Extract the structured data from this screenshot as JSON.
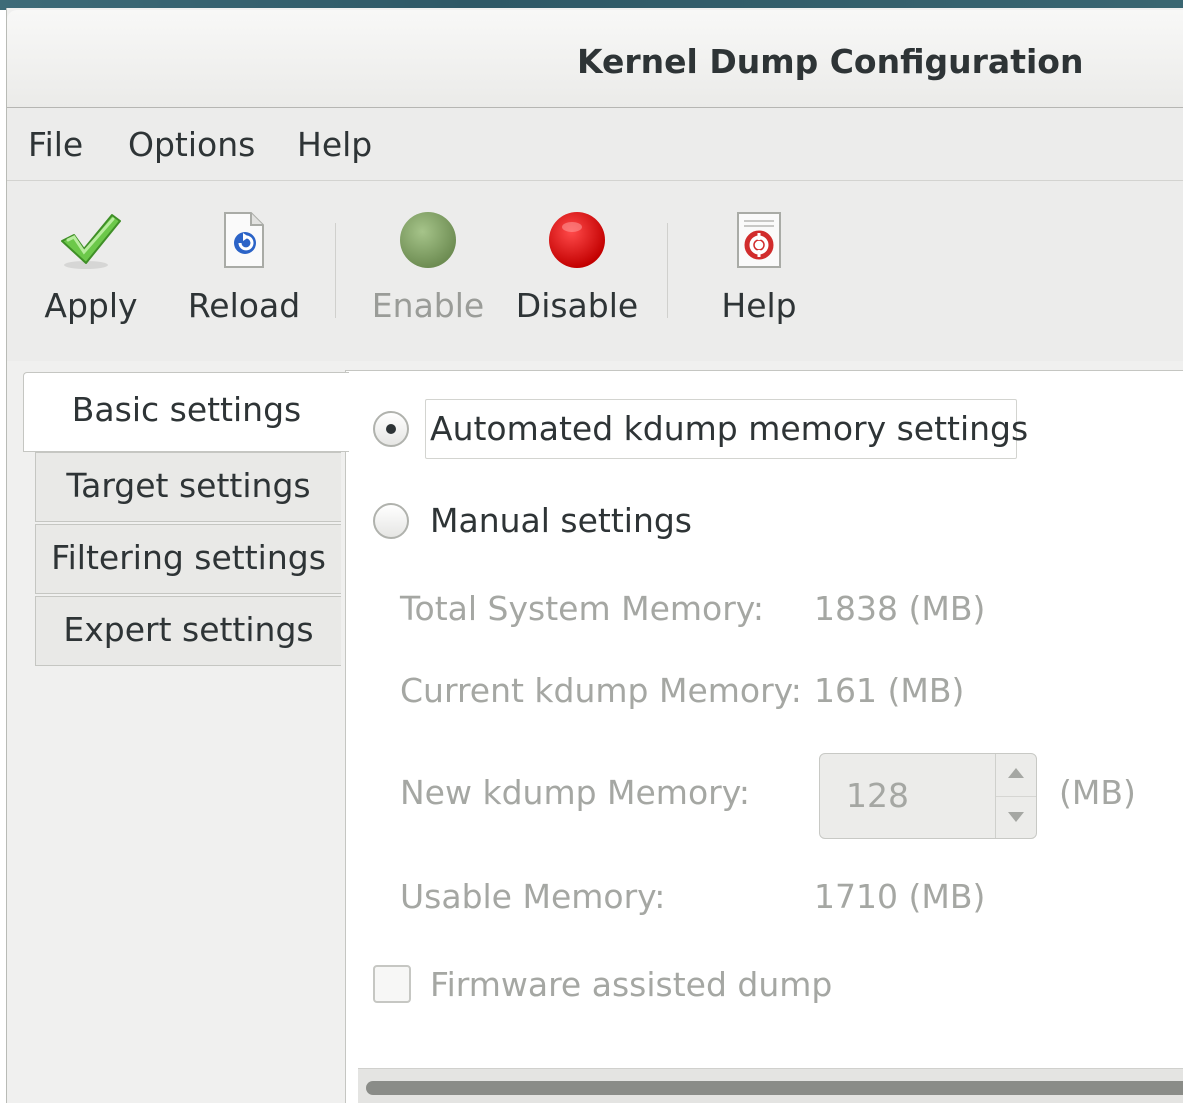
{
  "window": {
    "title": "Kernel Dump Configuration"
  },
  "menu": {
    "items": [
      {
        "label": "File"
      },
      {
        "label": "Options"
      },
      {
        "label": "Help"
      }
    ]
  },
  "toolbar": {
    "apply": {
      "label": "Apply",
      "icon": "checkmark-icon",
      "enabled": true
    },
    "reload": {
      "label": "Reload",
      "icon": "reload-icon",
      "enabled": true
    },
    "enable": {
      "label": "Enable",
      "icon": "green-circle-icon",
      "enabled": false
    },
    "disable": {
      "label": "Disable",
      "icon": "red-circle-icon",
      "enabled": true
    },
    "help": {
      "label": "Help",
      "icon": "help-lifebuoy-icon",
      "enabled": true
    }
  },
  "tabs": [
    {
      "label": "Basic settings",
      "active": true
    },
    {
      "label": "Target settings",
      "active": false
    },
    {
      "label": "Filtering settings",
      "active": false
    },
    {
      "label": "Expert settings",
      "active": false
    }
  ],
  "basic": {
    "automated_label": "Automated kdump memory settings",
    "automated_selected": true,
    "manual_label": "Manual settings",
    "manual_selected": false,
    "total_label": "Total System Memory:",
    "total_value": "1838 (MB)",
    "current_label": "Current kdump Memory:",
    "current_value": "161 (MB)",
    "new_label": "New kdump Memory:",
    "new_value": "128",
    "new_unit": "(MB)",
    "usable_label": "Usable Memory:",
    "usable_value": "1710 (MB)",
    "firmware_label": "Firmware assisted dump",
    "firmware_checked": false
  },
  "colors": {
    "enable_icon": "#7a9a5a",
    "disable_icon": "#e00000",
    "apply_check": "#5cbf3a"
  }
}
